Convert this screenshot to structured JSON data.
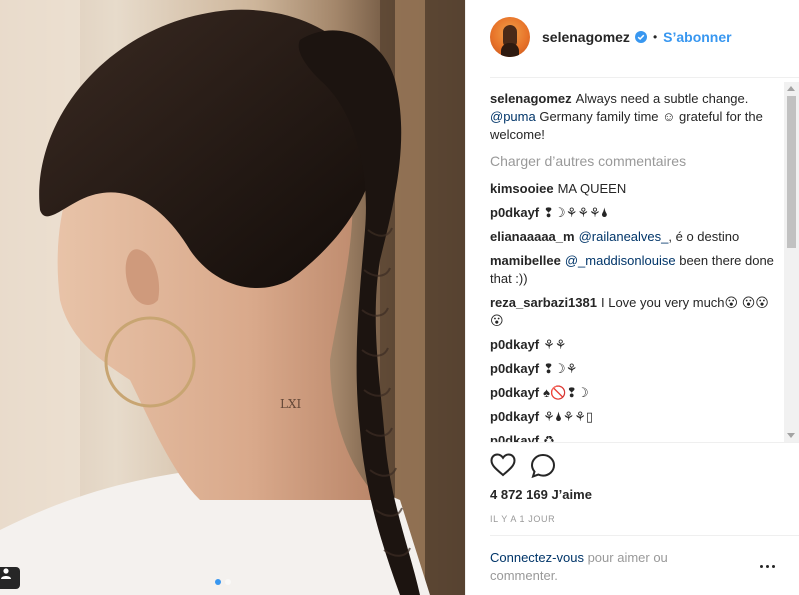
{
  "post": {
    "username": "selenagomez",
    "follow_label": "S’abonner",
    "separator": "•",
    "caption": {
      "text_1": "Always need a subtle change.",
      "mention": "@puma",
      "text_2": "Germany family time ☺ grateful for the welcome!"
    },
    "load_more_label": "Charger d’autres commentaires",
    "comments": [
      {
        "user": "kimsooiee",
        "text": "MA QUEEN"
      },
      {
        "user": "p0dkayf",
        "text": "❢☽⚘⚘⚘🌢"
      },
      {
        "user": "elianaaaaa_m",
        "mention": "@railanealves_",
        "text": ", é o destino"
      },
      {
        "user": "mamibellee",
        "mention": "@_maddisonlouise",
        "text": "been there done that :))"
      },
      {
        "user": "reza_sarbazi1381",
        "text": "I Love you very much😮 😮😮😮"
      },
      {
        "user": "p0dkayf",
        "text": "⚘⚘"
      },
      {
        "user": "p0dkayf",
        "text": "❢☽⚘"
      },
      {
        "user": "p0dkayf",
        "text": "♠🚫❢☽"
      },
      {
        "user": "p0dkayf",
        "text": "⚘🌢⚘⚘▯"
      },
      {
        "user": "p0dkayf",
        "text": "♻"
      }
    ],
    "likes": "4 872 169 J’aime",
    "time": "IL Y A 1 JOUR",
    "login_link": "Connectez-vous",
    "login_text": "pour aimer ou commenter."
  },
  "icons": {
    "like": "heart-icon",
    "comment": "comment-bubble-icon",
    "verified": "verified-badge-icon",
    "more": "more-options-icon",
    "tag": "user-tag-icon"
  },
  "colors": {
    "link": "#3897f0",
    "mention": "#003569",
    "muted": "#999999"
  }
}
